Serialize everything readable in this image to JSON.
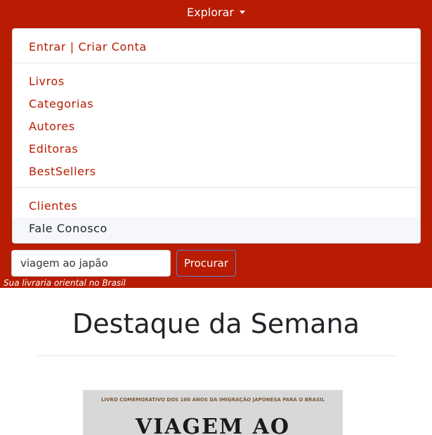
{
  "nav": {
    "explore_label": "Explorar",
    "menu": {
      "account_label": "Entrar | Criar Conta",
      "catalog_items": [
        "Livros",
        "Categorias",
        "Autores",
        "Editoras",
        "BestSellers"
      ],
      "support_items": [
        "Clientes",
        "Fale Conosco"
      ]
    }
  },
  "search": {
    "value": "viagem ao japão",
    "button_label": "Procurar"
  },
  "tagline": "Sua livraria oriental no Brasil",
  "featured": {
    "title": "Destaque da Semana",
    "book": {
      "cover_subtitle": "LIVRO COMEMORATIVO DOS 100 ANOS DA IMIGRAÇÃO JAPONESA PARA O BRASIL",
      "cover_title": "VIAGEM AO"
    }
  },
  "colors": {
    "brand": "#b81c02",
    "link": "#b81c02",
    "text": "#212529"
  }
}
